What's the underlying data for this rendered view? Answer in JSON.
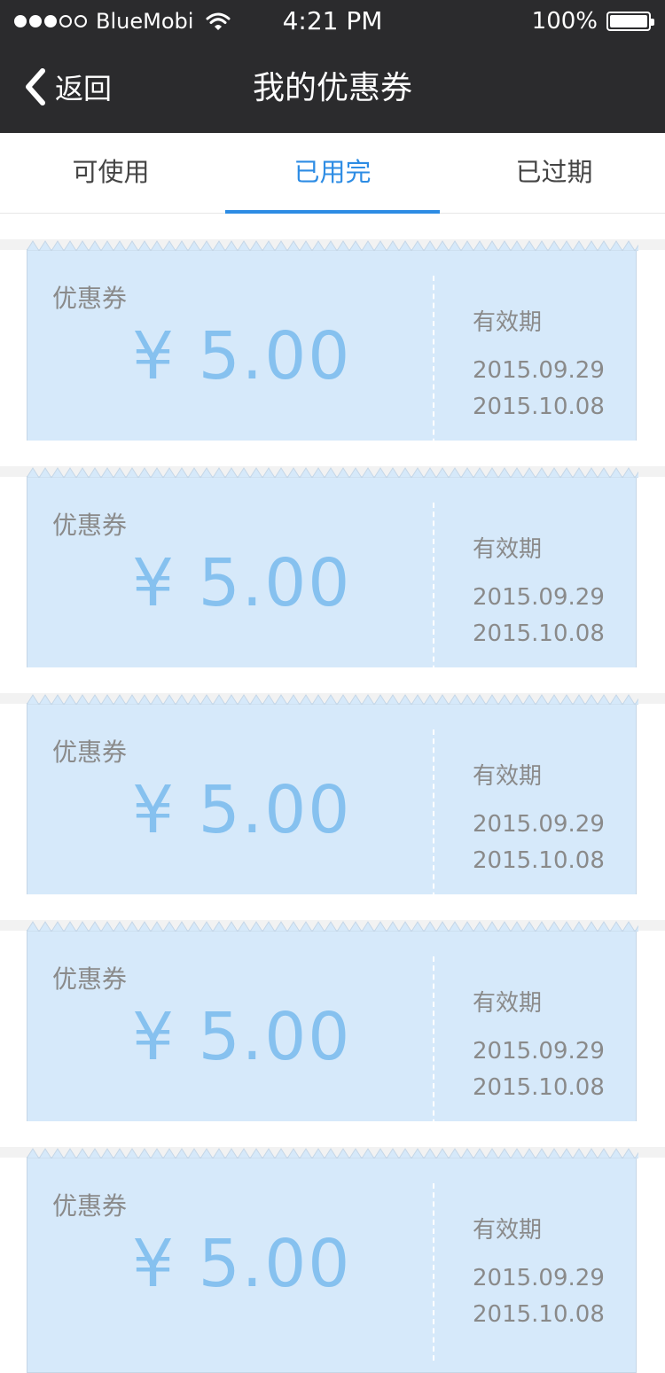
{
  "status_bar": {
    "carrier": "BlueMobi",
    "time": "4:21 PM",
    "battery": "100%"
  },
  "nav": {
    "back_label": "返回",
    "title": "我的优惠券"
  },
  "tabs": [
    {
      "label": "可使用",
      "active": false
    },
    {
      "label": "已用完",
      "active": true
    },
    {
      "label": "已过期",
      "active": false
    }
  ],
  "colors": {
    "accent": "#2d8ce4",
    "coupon_bg": "#d6e9fa",
    "amount": "#86c1ef",
    "nav_bg": "#2b2b2d"
  },
  "coupons": [
    {
      "label": "优惠券",
      "amount": "¥ 5.00",
      "validity_label": "有效期",
      "start": "2015.09.29",
      "end": "2015.10.08"
    },
    {
      "label": "优惠券",
      "amount": "¥ 5.00",
      "validity_label": "有效期",
      "start": "2015.09.29",
      "end": "2015.10.08"
    },
    {
      "label": "优惠券",
      "amount": "¥ 5.00",
      "validity_label": "有效期",
      "start": "2015.09.29",
      "end": "2015.10.08"
    },
    {
      "label": "优惠券",
      "amount": "¥ 5.00",
      "validity_label": "有效期",
      "start": "2015.09.29",
      "end": "2015.10.08"
    },
    {
      "label": "优惠券",
      "amount": "¥ 5.00",
      "validity_label": "有效期",
      "start": "2015.09.29",
      "end": "2015.10.08"
    }
  ]
}
